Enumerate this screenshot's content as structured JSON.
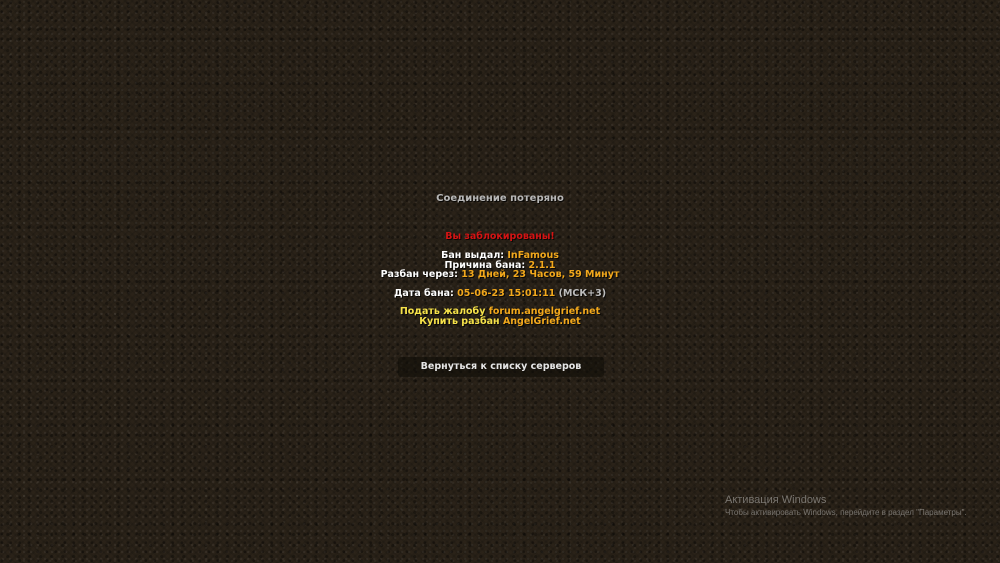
{
  "title": "Соединение потеряно",
  "banned_message": "Вы заблокированы!",
  "ban_info": {
    "issuer_label": "Бан выдал:",
    "issuer_value": "InFamous",
    "reason_label": "Причина бана:",
    "reason_value": "2.1.1",
    "unban_label": "Разбан через:",
    "unban_value": "13 Дней, 23 Часов, 59 Минут",
    "date_label": "Дата бана:",
    "date_value": "05-06-23 15:01:11",
    "timezone": "(МСК+3)"
  },
  "links": {
    "complaint_label": "Подать жалобу",
    "complaint_url": "forum.angelgrief.net",
    "buy_label": "Купить разбан",
    "buy_url": "AngelGrief.net"
  },
  "back_button_label": "Вернуться к списку серверов",
  "windows_activation": {
    "title": "Активация Windows",
    "subtitle": "Чтобы активировать Windows, перейдите в раздел \"Параметры\"."
  },
  "colors": {
    "title": "#b8b8b8",
    "banned": "#d41414",
    "value": "#f2a81c",
    "link_label": "#f6e24a"
  }
}
